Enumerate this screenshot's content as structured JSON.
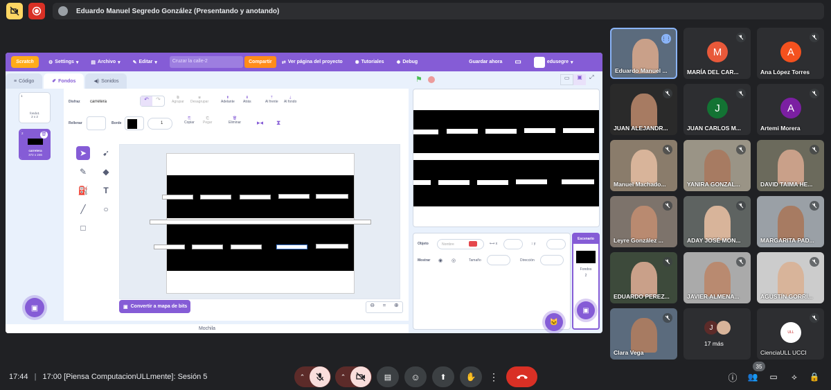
{
  "topbar": {
    "presenter_text": "Eduardo Manuel Segredo González (Presentando y anotando)"
  },
  "scratch": {
    "menu": {
      "logo": "Scratch",
      "settings": "Settings",
      "file": "Archivo",
      "edit": "Editar",
      "project_name": "Cruzar la calle-2",
      "share": "Compartir",
      "project_page": "Ver página del proyecto",
      "tutorials": "Tutoriales",
      "debug": "Debug",
      "save_now": "Guardar ahora",
      "username": "edusegre"
    },
    "tabs": {
      "code": "Código",
      "backdrops": "Fondos",
      "sounds": "Sonidos"
    },
    "costumes": [
      {
        "num": "1",
        "name": "fondo1",
        "size": "2 x 2"
      },
      {
        "num": "2",
        "name": "carretera",
        "size": "372 x 246"
      }
    ],
    "editor": {
      "costume_label": "Disfraz",
      "costume_name": "carretera",
      "group": "Agrupar",
      "ungroup": "Desagrupar",
      "forward": "Adelante",
      "backward": "Atrás",
      "front": "Al frente",
      "back": "Al fondo",
      "fill_label": "Rellenar",
      "outline_label": "Borde",
      "outline_width": "1",
      "copy": "Copiar",
      "paste": "Pegar",
      "delete": "Eliminar",
      "convert": "Convertir a mapa de bits",
      "zoom_reset": "="
    },
    "backpack": "Mochila",
    "sprite_info": {
      "sprite_label": "Objeto",
      "name_placeholder": "Nombre",
      "x_label": "x",
      "y_label": "y",
      "show_label": "Mostrar",
      "size_label": "Tamaño",
      "direction_label": "Dirección"
    },
    "stage_panel": {
      "title": "Escenario",
      "backdrops_label": "Fondos",
      "backdrops_count": "2"
    }
  },
  "participants": [
    {
      "name": "Eduardo Manuel ...",
      "type": "video",
      "speaking": true
    },
    {
      "name": "MARÍA DEL CAR...",
      "type": "avatar",
      "initial": "M",
      "color": "#e8593a"
    },
    {
      "name": "Ana López Torres",
      "type": "avatar",
      "initial": "A",
      "color": "#f4511e"
    },
    {
      "name": "JUAN ALEJANDR...",
      "type": "video"
    },
    {
      "name": "JUAN CARLOS M...",
      "type": "avatar",
      "initial": "J",
      "color": "#137333"
    },
    {
      "name": "Artemi Morera",
      "type": "avatar",
      "initial": "A",
      "color": "#7b1fa2"
    },
    {
      "name": "Manuel Machado...",
      "type": "video"
    },
    {
      "name": "YANIRA GONZAL...",
      "type": "video"
    },
    {
      "name": "DAVID TAIMA HE...",
      "type": "video"
    },
    {
      "name": "Leyre González ...",
      "type": "video"
    },
    {
      "name": "ADAY JOSÉ MON...",
      "type": "video"
    },
    {
      "name": "MARGARITA PAD...",
      "type": "video"
    },
    {
      "name": "EDUARDO PEREZ...",
      "type": "video"
    },
    {
      "name": "JAVIER ALMENA...",
      "type": "video"
    },
    {
      "name": "AGUSTÍN GORRÍ...",
      "type": "video"
    },
    {
      "name": "Clara Vega",
      "type": "video"
    },
    {
      "name": "17 más",
      "type": "more",
      "initial": "J"
    },
    {
      "name": "CienciaULL UCCI",
      "type": "logo"
    }
  ],
  "bottombar": {
    "time": "17:44",
    "meeting": "17:00 [Piensa ComputacionULLmente]: Sesión 5",
    "participant_count": "35"
  },
  "colors": {
    "meet_bg": "#202124",
    "scratch_purple": "#855cd6",
    "hangup_red": "#d93025",
    "muted_pink": "#f9dedc"
  }
}
